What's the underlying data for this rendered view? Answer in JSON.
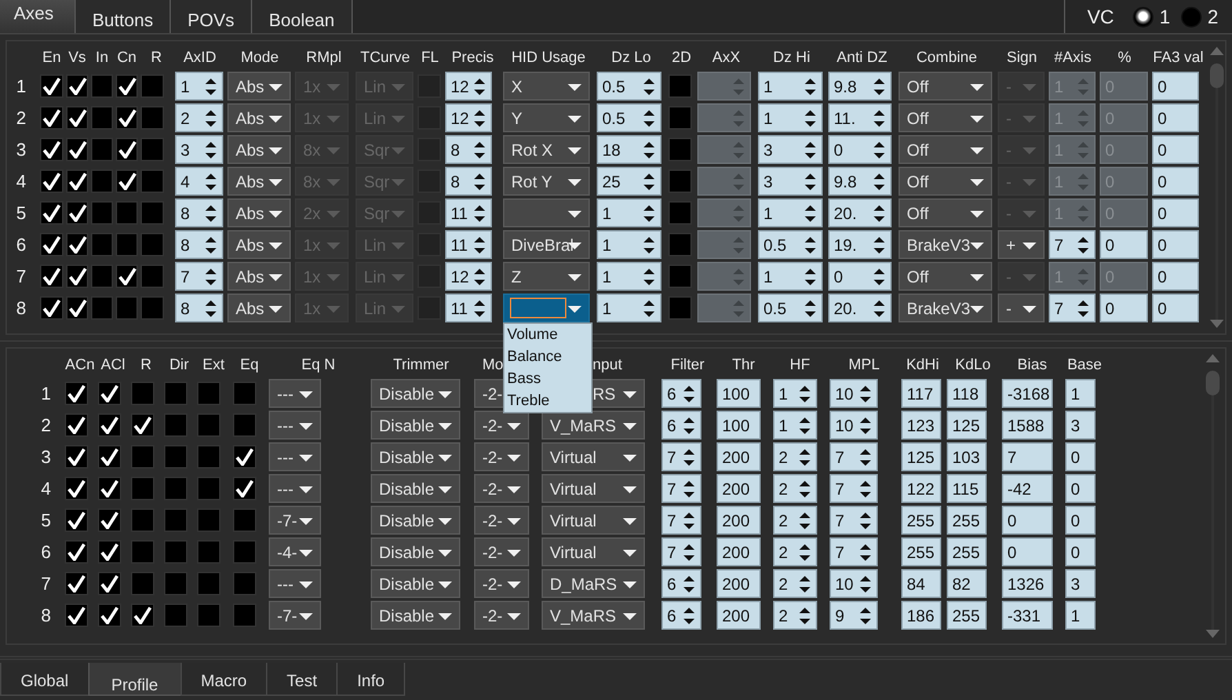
{
  "top_tabs": [
    {
      "label": "Axes",
      "selected": true
    },
    {
      "label": "Buttons",
      "selected": false
    },
    {
      "label": "POVs",
      "selected": false
    },
    {
      "label": "Boolean",
      "selected": false
    }
  ],
  "vc": {
    "label": "VC",
    "options": [
      {
        "label": "1",
        "selected": true
      },
      {
        "label": "2",
        "selected": false
      }
    ]
  },
  "axes_table": {
    "columns": [
      "En",
      "Vs",
      "In",
      "Cn",
      "R",
      "AxID",
      "Mode",
      "RMpl",
      "TCurve",
      "FL",
      "Precis",
      "HID Usage",
      "Dz Lo",
      "2D",
      "AxX",
      "Dz Hi",
      "Anti DZ",
      "Combine",
      "Sign",
      "#Axis",
      "%",
      "FA3 val"
    ],
    "rows": [
      {
        "number": "1",
        "cells": [
          {
            "kind": "check",
            "checked": true,
            "disabled": false
          },
          {
            "kind": "check",
            "checked": true,
            "disabled": false
          },
          {
            "kind": "check",
            "checked": false,
            "disabled": false
          },
          {
            "kind": "check",
            "checked": true,
            "disabled": false
          },
          {
            "kind": "check",
            "checked": false,
            "disabled": false
          },
          {
            "kind": "spin",
            "value": "1",
            "disabled": false
          },
          {
            "kind": "select",
            "value": "Abs",
            "disabled": false
          },
          {
            "kind": "select",
            "value": "1x",
            "disabled": true
          },
          {
            "kind": "select",
            "value": "Lin",
            "disabled": true
          },
          {
            "kind": "check",
            "checked": false,
            "disabled": true
          },
          {
            "kind": "spin",
            "value": "12",
            "disabled": false
          },
          {
            "kind": "select",
            "value": "X",
            "disabled": false,
            "open": false
          },
          {
            "kind": "spin",
            "value": "0.5",
            "disabled": false
          },
          {
            "kind": "check",
            "checked": false,
            "disabled": false
          },
          {
            "kind": "spin",
            "disabled": true
          },
          {
            "kind": "spin",
            "value": "1",
            "disabled": false
          },
          {
            "kind": "spin",
            "value": "9.8",
            "disabled": false
          },
          {
            "kind": "select",
            "value": "Off",
            "disabled": false
          },
          {
            "kind": "select",
            "value": "-",
            "disabled": true
          },
          {
            "kind": "spin",
            "value": "1",
            "disabled": true
          },
          {
            "kind": "field",
            "value": "0",
            "disabled": true
          },
          {
            "kind": "field",
            "value": "0",
            "disabled": false
          }
        ]
      },
      {
        "number": "2",
        "cells": [
          {
            "kind": "check",
            "checked": true,
            "disabled": false
          },
          {
            "kind": "check",
            "checked": true,
            "disabled": false
          },
          {
            "kind": "check",
            "checked": false,
            "disabled": false
          },
          {
            "kind": "check",
            "checked": true,
            "disabled": false
          },
          {
            "kind": "check",
            "checked": false,
            "disabled": false
          },
          {
            "kind": "spin",
            "value": "2",
            "disabled": false
          },
          {
            "kind": "select",
            "value": "Abs",
            "disabled": false
          },
          {
            "kind": "select",
            "value": "1x",
            "disabled": true
          },
          {
            "kind": "select",
            "value": "Lin",
            "disabled": true
          },
          {
            "kind": "check",
            "checked": false,
            "disabled": true
          },
          {
            "kind": "spin",
            "value": "12",
            "disabled": false
          },
          {
            "kind": "select",
            "value": "Y",
            "disabled": false,
            "open": false
          },
          {
            "kind": "spin",
            "value": "0.5",
            "disabled": false
          },
          {
            "kind": "check",
            "checked": false,
            "disabled": false
          },
          {
            "kind": "spin",
            "disabled": true
          },
          {
            "kind": "spin",
            "value": "1",
            "disabled": false
          },
          {
            "kind": "spin",
            "value": "11.",
            "disabled": false
          },
          {
            "kind": "select",
            "value": "Off",
            "disabled": false
          },
          {
            "kind": "select",
            "value": "-",
            "disabled": true
          },
          {
            "kind": "spin",
            "value": "1",
            "disabled": true
          },
          {
            "kind": "field",
            "value": "0",
            "disabled": true
          },
          {
            "kind": "field",
            "value": "0",
            "disabled": false
          }
        ]
      },
      {
        "number": "3",
        "cells": [
          {
            "kind": "check",
            "checked": true,
            "disabled": false
          },
          {
            "kind": "check",
            "checked": true,
            "disabled": false
          },
          {
            "kind": "check",
            "checked": false,
            "disabled": false
          },
          {
            "kind": "check",
            "checked": true,
            "disabled": false
          },
          {
            "kind": "check",
            "checked": false,
            "disabled": false
          },
          {
            "kind": "spin",
            "value": "3",
            "disabled": false
          },
          {
            "kind": "select",
            "value": "Abs",
            "disabled": false
          },
          {
            "kind": "select",
            "value": "8x",
            "disabled": true
          },
          {
            "kind": "select",
            "value": "Sqr",
            "disabled": true
          },
          {
            "kind": "check",
            "checked": false,
            "disabled": true
          },
          {
            "kind": "spin",
            "value": "8",
            "disabled": false
          },
          {
            "kind": "select",
            "value": "Rot X",
            "disabled": false,
            "open": false
          },
          {
            "kind": "spin",
            "value": "18",
            "disabled": false
          },
          {
            "kind": "check",
            "checked": false,
            "disabled": false
          },
          {
            "kind": "spin",
            "disabled": true
          },
          {
            "kind": "spin",
            "value": "3",
            "disabled": false
          },
          {
            "kind": "spin",
            "value": "0",
            "disabled": false
          },
          {
            "kind": "select",
            "value": "Off",
            "disabled": false
          },
          {
            "kind": "select",
            "value": "-",
            "disabled": true
          },
          {
            "kind": "spin",
            "value": "1",
            "disabled": true
          },
          {
            "kind": "field",
            "value": "0",
            "disabled": true
          },
          {
            "kind": "field",
            "value": "0",
            "disabled": false
          }
        ]
      },
      {
        "number": "4",
        "cells": [
          {
            "kind": "check",
            "checked": true,
            "disabled": false
          },
          {
            "kind": "check",
            "checked": true,
            "disabled": false
          },
          {
            "kind": "check",
            "checked": false,
            "disabled": false
          },
          {
            "kind": "check",
            "checked": true,
            "disabled": false
          },
          {
            "kind": "check",
            "checked": false,
            "disabled": false
          },
          {
            "kind": "spin",
            "value": "4",
            "disabled": false
          },
          {
            "kind": "select",
            "value": "Abs",
            "disabled": false
          },
          {
            "kind": "select",
            "value": "8x",
            "disabled": true
          },
          {
            "kind": "select",
            "value": "Sqr",
            "disabled": true
          },
          {
            "kind": "check",
            "checked": false,
            "disabled": true
          },
          {
            "kind": "spin",
            "value": "8",
            "disabled": false
          },
          {
            "kind": "select",
            "value": "Rot Y",
            "disabled": false,
            "open": false
          },
          {
            "kind": "spin",
            "value": "25",
            "disabled": false
          },
          {
            "kind": "check",
            "checked": false,
            "disabled": false
          },
          {
            "kind": "spin",
            "disabled": true
          },
          {
            "kind": "spin",
            "value": "3",
            "disabled": false
          },
          {
            "kind": "spin",
            "value": "9.8",
            "disabled": false
          },
          {
            "kind": "select",
            "value": "Off",
            "disabled": false
          },
          {
            "kind": "select",
            "value": "-",
            "disabled": true
          },
          {
            "kind": "spin",
            "value": "1",
            "disabled": true
          },
          {
            "kind": "field",
            "value": "0",
            "disabled": true
          },
          {
            "kind": "field",
            "value": "0",
            "disabled": false
          }
        ]
      },
      {
        "number": "5",
        "cells": [
          {
            "kind": "check",
            "checked": true,
            "disabled": false
          },
          {
            "kind": "check",
            "checked": true,
            "disabled": false
          },
          {
            "kind": "check",
            "checked": false,
            "disabled": false
          },
          {
            "kind": "check",
            "checked": false,
            "disabled": false
          },
          {
            "kind": "check",
            "checked": false,
            "disabled": false
          },
          {
            "kind": "spin",
            "value": "8",
            "disabled": false
          },
          {
            "kind": "select",
            "value": "Abs",
            "disabled": false
          },
          {
            "kind": "select",
            "value": "2x",
            "disabled": true
          },
          {
            "kind": "select",
            "value": "Sqr",
            "disabled": true
          },
          {
            "kind": "check",
            "checked": false,
            "disabled": true
          },
          {
            "kind": "spin",
            "value": "11",
            "disabled": false
          },
          {
            "kind": "select",
            "disabled": false,
            "open": false
          },
          {
            "kind": "spin",
            "value": "1",
            "disabled": false
          },
          {
            "kind": "check",
            "checked": false,
            "disabled": false
          },
          {
            "kind": "spin",
            "disabled": true
          },
          {
            "kind": "spin",
            "value": "1",
            "disabled": false
          },
          {
            "kind": "spin",
            "value": "20.",
            "disabled": false
          },
          {
            "kind": "select",
            "value": "Off",
            "disabled": false
          },
          {
            "kind": "select",
            "value": "-",
            "disabled": true
          },
          {
            "kind": "spin",
            "value": "1",
            "disabled": true
          },
          {
            "kind": "field",
            "value": "0",
            "disabled": true
          },
          {
            "kind": "field",
            "value": "0",
            "disabled": false
          }
        ]
      },
      {
        "number": "6",
        "cells": [
          {
            "kind": "check",
            "checked": true,
            "disabled": false
          },
          {
            "kind": "check",
            "checked": true,
            "disabled": false
          },
          {
            "kind": "check",
            "checked": false,
            "disabled": false
          },
          {
            "kind": "check",
            "checked": false,
            "disabled": false
          },
          {
            "kind": "check",
            "checked": false,
            "disabled": false
          },
          {
            "kind": "spin",
            "value": "8",
            "disabled": false
          },
          {
            "kind": "select",
            "value": "Abs",
            "disabled": false
          },
          {
            "kind": "select",
            "value": "1x",
            "disabled": true
          },
          {
            "kind": "select",
            "value": "Lin",
            "disabled": true
          },
          {
            "kind": "check",
            "checked": false,
            "disabled": true
          },
          {
            "kind": "spin",
            "value": "11",
            "disabled": false
          },
          {
            "kind": "select",
            "value": "DiveBral",
            "disabled": false,
            "open": false
          },
          {
            "kind": "spin",
            "value": "1",
            "disabled": false
          },
          {
            "kind": "check",
            "checked": false,
            "disabled": false
          },
          {
            "kind": "spin",
            "disabled": true
          },
          {
            "kind": "spin",
            "value": "0.5",
            "disabled": false
          },
          {
            "kind": "spin",
            "value": "19.",
            "disabled": false
          },
          {
            "kind": "select",
            "value": "BrakeV3",
            "disabled": false
          },
          {
            "kind": "select",
            "value": "+",
            "disabled": false
          },
          {
            "kind": "spin",
            "value": "7",
            "disabled": false
          },
          {
            "kind": "field",
            "value": "0",
            "disabled": false
          },
          {
            "kind": "field",
            "value": "0",
            "disabled": false
          }
        ]
      },
      {
        "number": "7",
        "cells": [
          {
            "kind": "check",
            "checked": true,
            "disabled": false
          },
          {
            "kind": "check",
            "checked": true,
            "disabled": false
          },
          {
            "kind": "check",
            "checked": false,
            "disabled": false
          },
          {
            "kind": "check",
            "checked": true,
            "disabled": false
          },
          {
            "kind": "check",
            "checked": false,
            "disabled": false
          },
          {
            "kind": "spin",
            "value": "7",
            "disabled": false
          },
          {
            "kind": "select",
            "value": "Abs",
            "disabled": false
          },
          {
            "kind": "select",
            "value": "1x",
            "disabled": true
          },
          {
            "kind": "select",
            "value": "Lin",
            "disabled": true
          },
          {
            "kind": "check",
            "checked": false,
            "disabled": true
          },
          {
            "kind": "spin",
            "value": "12",
            "disabled": false
          },
          {
            "kind": "select",
            "value": "Z",
            "disabled": false,
            "open": false
          },
          {
            "kind": "spin",
            "value": "1",
            "disabled": false
          },
          {
            "kind": "check",
            "checked": false,
            "disabled": false
          },
          {
            "kind": "spin",
            "disabled": true
          },
          {
            "kind": "spin",
            "value": "1",
            "disabled": false
          },
          {
            "kind": "spin",
            "value": "0",
            "disabled": false
          },
          {
            "kind": "select",
            "value": "Off",
            "disabled": false
          },
          {
            "kind": "select",
            "value": "-",
            "disabled": true
          },
          {
            "kind": "spin",
            "value": "1",
            "disabled": true
          },
          {
            "kind": "field",
            "value": "0",
            "disabled": true
          },
          {
            "kind": "field",
            "value": "0",
            "disabled": false
          }
        ]
      },
      {
        "number": "8",
        "cells": [
          {
            "kind": "check",
            "checked": true,
            "disabled": false
          },
          {
            "kind": "check",
            "checked": true,
            "disabled": false
          },
          {
            "kind": "check",
            "checked": false,
            "disabled": false
          },
          {
            "kind": "check",
            "checked": false,
            "disabled": false
          },
          {
            "kind": "check",
            "checked": false,
            "disabled": false
          },
          {
            "kind": "spin",
            "value": "8",
            "disabled": false
          },
          {
            "kind": "select",
            "value": "Abs",
            "disabled": false
          },
          {
            "kind": "select",
            "value": "1x",
            "disabled": true
          },
          {
            "kind": "select",
            "value": "Lin",
            "disabled": true
          },
          {
            "kind": "check",
            "checked": false,
            "disabled": true
          },
          {
            "kind": "spin",
            "value": "11",
            "disabled": false
          },
          {
            "kind": "select",
            "disabled": false,
            "open": true,
            "options": [
              "Volume",
              "Balance",
              "Bass",
              "Treble"
            ]
          },
          {
            "kind": "spin",
            "value": "1",
            "disabled": false
          },
          {
            "kind": "check",
            "checked": false,
            "disabled": false
          },
          {
            "kind": "spin",
            "disabled": true
          },
          {
            "kind": "spin",
            "value": "0.5",
            "disabled": false
          },
          {
            "kind": "spin",
            "value": "20.",
            "disabled": false
          },
          {
            "kind": "select",
            "value": "BrakeV3",
            "disabled": false
          },
          {
            "kind": "select",
            "value": "-",
            "disabled": false
          },
          {
            "kind": "spin",
            "value": "7",
            "disabled": false
          },
          {
            "kind": "field",
            "value": "0",
            "disabled": false
          },
          {
            "kind": "field",
            "value": "0",
            "disabled": false
          }
        ]
      }
    ]
  },
  "profile_table": {
    "columns": [
      "ACn",
      "ACl",
      "R",
      "Dir",
      "Ext",
      "Eq",
      "Eq N",
      "Trimmer",
      "Mo",
      "nput",
      "Filter",
      "Thr",
      "HF",
      "MPL",
      "KdHi",
      "KdLo",
      "Bias",
      "Base"
    ],
    "rows": [
      {
        "number": "1",
        "cells": [
          {
            "kind": "check",
            "checked": true
          },
          {
            "kind": "check",
            "checked": true
          },
          {
            "kind": "check",
            "checked": false
          },
          {
            "kind": "check",
            "checked": false
          },
          {
            "kind": "check",
            "checked": false
          },
          {
            "kind": "check",
            "checked": false
          },
          {
            "kind": "select",
            "value": "---"
          },
          {
            "kind": "select",
            "value": "Disable"
          },
          {
            "kind": "select",
            "value": "-2-"
          },
          {
            "kind": "select",
            "value": "RS"
          },
          {
            "kind": "spin",
            "value": "6"
          },
          {
            "kind": "field",
            "value": "100"
          },
          {
            "kind": "spin",
            "value": "1"
          },
          {
            "kind": "spin",
            "value": "10"
          },
          {
            "kind": "field",
            "value": "117"
          },
          {
            "kind": "field",
            "value": "118"
          },
          {
            "kind": "field",
            "value": "-3168"
          },
          {
            "kind": "field",
            "value": "1"
          }
        ]
      },
      {
        "number": "2",
        "cells": [
          {
            "kind": "check",
            "checked": true
          },
          {
            "kind": "check",
            "checked": true
          },
          {
            "kind": "check",
            "checked": true
          },
          {
            "kind": "check",
            "checked": false
          },
          {
            "kind": "check",
            "checked": false
          },
          {
            "kind": "check",
            "checked": false
          },
          {
            "kind": "select",
            "value": "---"
          },
          {
            "kind": "select",
            "value": "Disable"
          },
          {
            "kind": "select",
            "value": "-2-"
          },
          {
            "kind": "select",
            "value": "V_MaRS"
          },
          {
            "kind": "spin",
            "value": "6"
          },
          {
            "kind": "field",
            "value": "100"
          },
          {
            "kind": "spin",
            "value": "1"
          },
          {
            "kind": "spin",
            "value": "10"
          },
          {
            "kind": "field",
            "value": "123"
          },
          {
            "kind": "field",
            "value": "125"
          },
          {
            "kind": "field",
            "value": "1588"
          },
          {
            "kind": "field",
            "value": "3"
          }
        ]
      },
      {
        "number": "3",
        "cells": [
          {
            "kind": "check",
            "checked": true
          },
          {
            "kind": "check",
            "checked": true
          },
          {
            "kind": "check",
            "checked": false
          },
          {
            "kind": "check",
            "checked": false
          },
          {
            "kind": "check",
            "checked": false
          },
          {
            "kind": "check",
            "checked": true
          },
          {
            "kind": "select",
            "value": "---"
          },
          {
            "kind": "select",
            "value": "Disable"
          },
          {
            "kind": "select",
            "value": "-2-"
          },
          {
            "kind": "select",
            "value": "Virtual"
          },
          {
            "kind": "spin",
            "value": "7"
          },
          {
            "kind": "field",
            "value": "200"
          },
          {
            "kind": "spin",
            "value": "2"
          },
          {
            "kind": "spin",
            "value": "7"
          },
          {
            "kind": "field",
            "value": "125"
          },
          {
            "kind": "field",
            "value": "103"
          },
          {
            "kind": "field",
            "value": "7"
          },
          {
            "kind": "field",
            "value": "0"
          }
        ]
      },
      {
        "number": "4",
        "cells": [
          {
            "kind": "check",
            "checked": true
          },
          {
            "kind": "check",
            "checked": true
          },
          {
            "kind": "check",
            "checked": false
          },
          {
            "kind": "check",
            "checked": false
          },
          {
            "kind": "check",
            "checked": false
          },
          {
            "kind": "check",
            "checked": true
          },
          {
            "kind": "select",
            "value": "---"
          },
          {
            "kind": "select",
            "value": "Disable"
          },
          {
            "kind": "select",
            "value": "-2-"
          },
          {
            "kind": "select",
            "value": "Virtual"
          },
          {
            "kind": "spin",
            "value": "7"
          },
          {
            "kind": "field",
            "value": "200"
          },
          {
            "kind": "spin",
            "value": "2"
          },
          {
            "kind": "spin",
            "value": "7"
          },
          {
            "kind": "field",
            "value": "122"
          },
          {
            "kind": "field",
            "value": "115"
          },
          {
            "kind": "field",
            "value": "-42"
          },
          {
            "kind": "field",
            "value": "0"
          }
        ]
      },
      {
        "number": "5",
        "cells": [
          {
            "kind": "check",
            "checked": true
          },
          {
            "kind": "check",
            "checked": true
          },
          {
            "kind": "check",
            "checked": false
          },
          {
            "kind": "check",
            "checked": false
          },
          {
            "kind": "check",
            "checked": false
          },
          {
            "kind": "check",
            "checked": false
          },
          {
            "kind": "select",
            "value": "-7-"
          },
          {
            "kind": "select",
            "value": "Disable"
          },
          {
            "kind": "select",
            "value": "-2-"
          },
          {
            "kind": "select",
            "value": "Virtual"
          },
          {
            "kind": "spin",
            "value": "7"
          },
          {
            "kind": "field",
            "value": "200"
          },
          {
            "kind": "spin",
            "value": "2"
          },
          {
            "kind": "spin",
            "value": "7"
          },
          {
            "kind": "field",
            "value": "255"
          },
          {
            "kind": "field",
            "value": "255"
          },
          {
            "kind": "field",
            "value": "0"
          },
          {
            "kind": "field",
            "value": "0"
          }
        ]
      },
      {
        "number": "6",
        "cells": [
          {
            "kind": "check",
            "checked": true
          },
          {
            "kind": "check",
            "checked": true
          },
          {
            "kind": "check",
            "checked": false
          },
          {
            "kind": "check",
            "checked": false
          },
          {
            "kind": "check",
            "checked": false
          },
          {
            "kind": "check",
            "checked": false
          },
          {
            "kind": "select",
            "value": "-4-"
          },
          {
            "kind": "select",
            "value": "Disable"
          },
          {
            "kind": "select",
            "value": "-2-"
          },
          {
            "kind": "select",
            "value": "Virtual"
          },
          {
            "kind": "spin",
            "value": "7"
          },
          {
            "kind": "field",
            "value": "200"
          },
          {
            "kind": "spin",
            "value": "2"
          },
          {
            "kind": "spin",
            "value": "7"
          },
          {
            "kind": "field",
            "value": "255"
          },
          {
            "kind": "field",
            "value": "255"
          },
          {
            "kind": "field",
            "value": "0"
          },
          {
            "kind": "field",
            "value": "0"
          }
        ]
      },
      {
        "number": "7",
        "cells": [
          {
            "kind": "check",
            "checked": true
          },
          {
            "kind": "check",
            "checked": true
          },
          {
            "kind": "check",
            "checked": false
          },
          {
            "kind": "check",
            "checked": false
          },
          {
            "kind": "check",
            "checked": false
          },
          {
            "kind": "check",
            "checked": false
          },
          {
            "kind": "select",
            "value": "---"
          },
          {
            "kind": "select",
            "value": "Disable"
          },
          {
            "kind": "select",
            "value": "-2-"
          },
          {
            "kind": "select",
            "value": "D_MaRS"
          },
          {
            "kind": "spin",
            "value": "6"
          },
          {
            "kind": "field",
            "value": "200"
          },
          {
            "kind": "spin",
            "value": "2"
          },
          {
            "kind": "spin",
            "value": "10"
          },
          {
            "kind": "field",
            "value": "84"
          },
          {
            "kind": "field",
            "value": "82"
          },
          {
            "kind": "field",
            "value": "1326"
          },
          {
            "kind": "field",
            "value": "3"
          }
        ]
      },
      {
        "number": "8",
        "cells": [
          {
            "kind": "check",
            "checked": true
          },
          {
            "kind": "check",
            "checked": true
          },
          {
            "kind": "check",
            "checked": true
          },
          {
            "kind": "check",
            "checked": false
          },
          {
            "kind": "check",
            "checked": false
          },
          {
            "kind": "check",
            "checked": false
          },
          {
            "kind": "select",
            "value": "-7-"
          },
          {
            "kind": "select",
            "value": "Disable"
          },
          {
            "kind": "select",
            "value": "-2-"
          },
          {
            "kind": "select",
            "value": "V_MaRS"
          },
          {
            "kind": "spin",
            "value": "6"
          },
          {
            "kind": "field",
            "value": "200"
          },
          {
            "kind": "spin",
            "value": "2"
          },
          {
            "kind": "spin",
            "value": "9"
          },
          {
            "kind": "field",
            "value": "186"
          },
          {
            "kind": "field",
            "value": "255"
          },
          {
            "kind": "field",
            "value": "-331"
          },
          {
            "kind": "field",
            "value": "1"
          }
        ]
      }
    ]
  },
  "bottom_tabs": [
    {
      "label": "Global",
      "selected": false
    },
    {
      "label": "Profile",
      "selected": true
    },
    {
      "label": "Macro",
      "selected": false
    },
    {
      "label": "Test",
      "selected": false
    },
    {
      "label": "Info",
      "selected": false
    }
  ]
}
